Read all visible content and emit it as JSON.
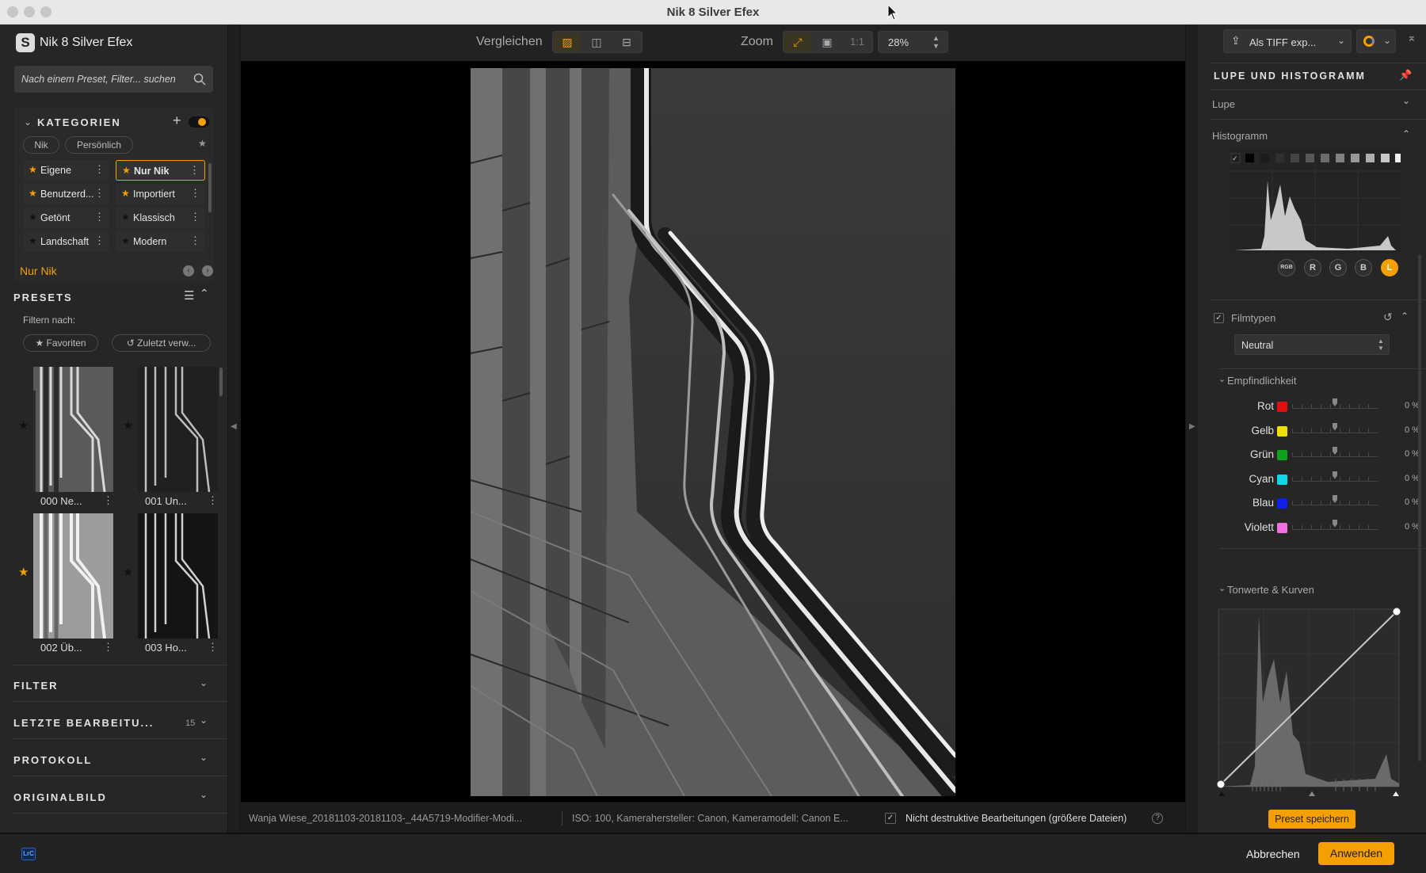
{
  "window": {
    "title": "Nik 8 Silver Efex"
  },
  "app": {
    "name": "Nik 8 Silver Efex",
    "logo_letter": "S"
  },
  "search": {
    "placeholder": "Nach einem Preset, Filter... suchen"
  },
  "categories": {
    "title": "KATEGORIEN",
    "tabs": [
      "Nik",
      "Persönlich"
    ],
    "items": [
      {
        "label": "Eigene",
        "starred": true
      },
      {
        "label": "Nur Nik",
        "starred": true,
        "selected": true
      },
      {
        "label": "Benutzerd...",
        "starred": true
      },
      {
        "label": "Importiert",
        "starred": true
      },
      {
        "label": "Getönt",
        "starred": false
      },
      {
        "label": "Klassisch",
        "starred": false
      },
      {
        "label": "Landschaft",
        "starred": false
      },
      {
        "label": "Modern",
        "starred": false
      }
    ],
    "current": "Nur Nik"
  },
  "presets": {
    "title": "PRESETS",
    "filter_label": "Filtern nach:",
    "filters": [
      "Favoriten",
      "Zuletzt verw..."
    ],
    "items": [
      {
        "label": "000 Ne...",
        "favorite": false
      },
      {
        "label": "001 Un...",
        "favorite": false
      },
      {
        "label": "002 Üb...",
        "favorite": true
      },
      {
        "label": "003 Ho...",
        "favorite": false
      }
    ]
  },
  "collapsed_sections": [
    {
      "label": "FILTER",
      "count": ""
    },
    {
      "label": "LETZTE BEARBEITU...",
      "count": "15"
    },
    {
      "label": "PROTOKOLL",
      "count": ""
    },
    {
      "label": "ORIGINALBILD",
      "count": ""
    }
  ],
  "toolbar": {
    "compare_label": "Vergleichen",
    "zoom_label": "Zoom",
    "one_to_one": "1:1",
    "zoom_value": "28%"
  },
  "status": {
    "filename": "Wanja Wiese_20181103-20181103-_44A5719-Modifier-Modi...",
    "meta": "ISO: 100, Kamerahersteller: Canon, Kameramodell: Canon E...",
    "nondestructive": "Nicht destruktive Bearbeitungen (größere Dateien)",
    "help": "?"
  },
  "export": {
    "label": "Als TIFF exp..."
  },
  "right": {
    "panel_title": "LUPE UND HISTOGRAMM",
    "lupe": "Lupe",
    "histogram": "Histogramm",
    "channels": [
      "RGB",
      "R",
      "G",
      "B",
      "L"
    ],
    "filmtypes": {
      "label": "Filmtypen",
      "value": "Neutral"
    },
    "sensitivity": {
      "label": "Empfindlichkeit",
      "rows": [
        {
          "label": "Rot",
          "color": "#e01010",
          "value": "0 %"
        },
        {
          "label": "Gelb",
          "color": "#f0e000",
          "value": "0 %"
        },
        {
          "label": "Grün",
          "color": "#10a020",
          "value": "0 %"
        },
        {
          "label": "Cyan",
          "color": "#10d8e8",
          "value": "0 %"
        },
        {
          "label": "Blau",
          "color": "#1020e8",
          "value": "0 %"
        },
        {
          "label": "Violett",
          "color": "#f070e0",
          "value": "0 %"
        }
      ]
    },
    "curves": "Tonwerte & Kurven",
    "save_preset": "Preset speichern"
  },
  "bottom": {
    "lrc": "LrC",
    "cancel": "Abbrechen",
    "apply": "Anwenden"
  },
  "colors": {
    "accent": "#f5a000"
  }
}
